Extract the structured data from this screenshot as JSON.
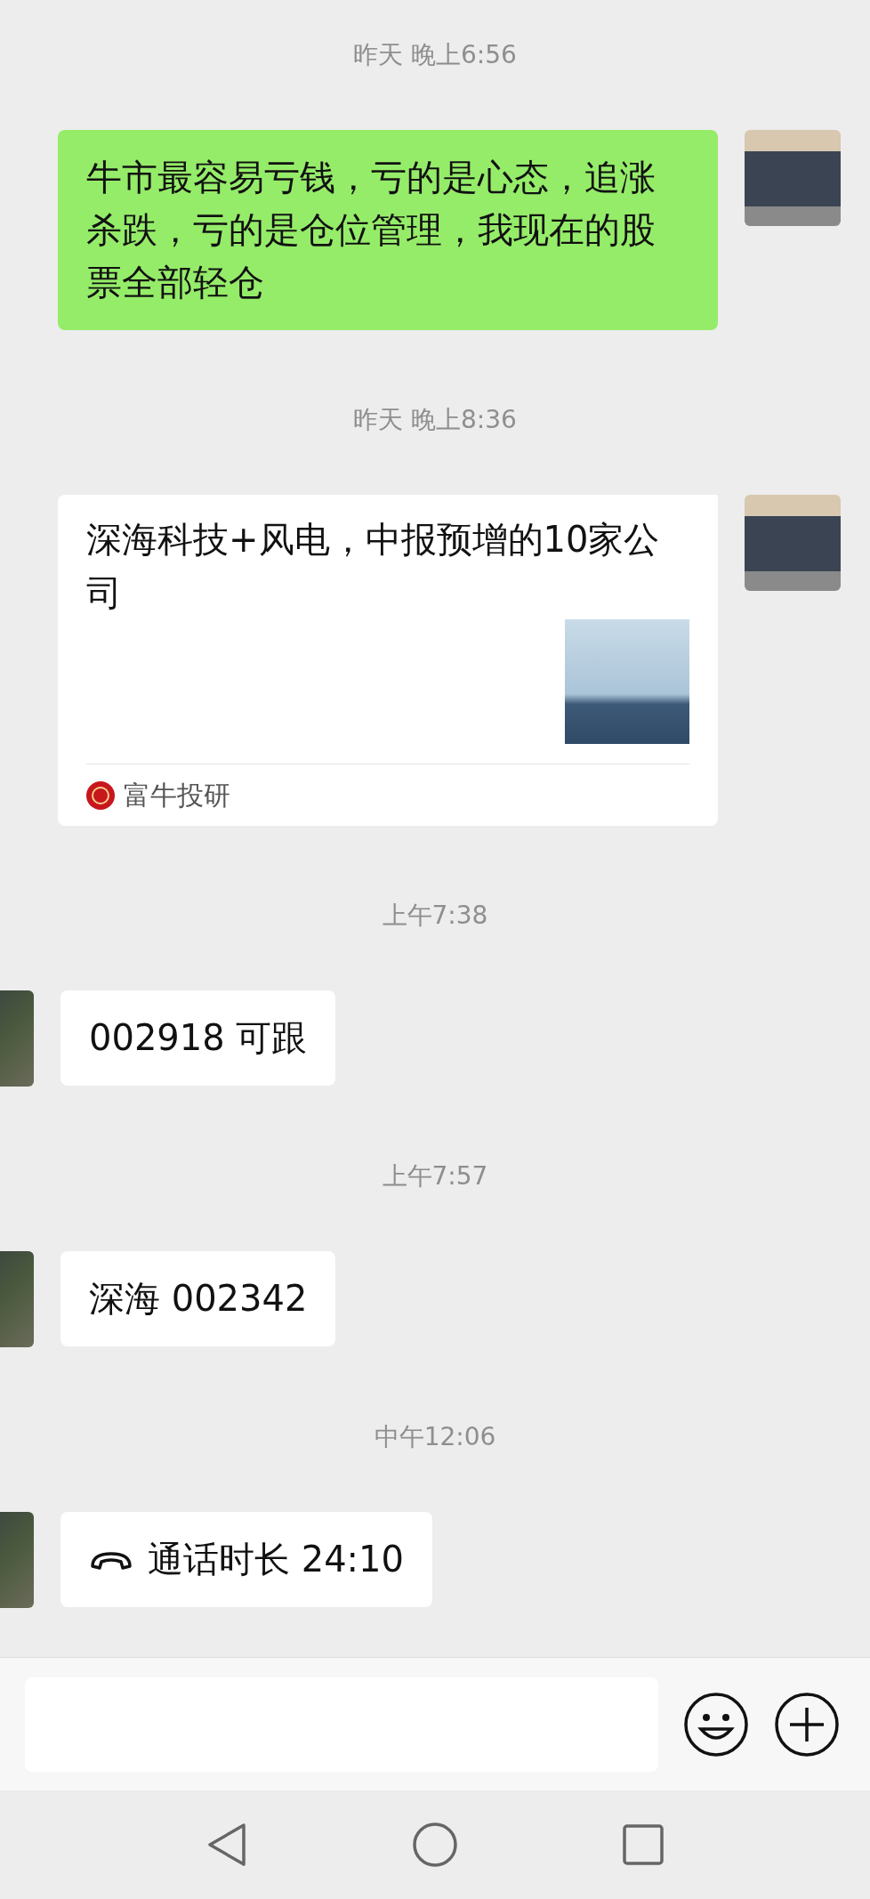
{
  "messages": [
    {
      "kind": "time",
      "text": "昨天 晚上6:56"
    },
    {
      "kind": "text",
      "mine": true,
      "text": "牛市最容易亏钱，亏的是心态，追涨杀跌，亏的是仓位管理，我现在的股票全部轻仓"
    },
    {
      "kind": "time",
      "text": "昨天 晚上8:36"
    },
    {
      "kind": "link",
      "mine": true,
      "title": "深海科技+风电，中报预增的10家公司",
      "source": "富牛投研"
    },
    {
      "kind": "time",
      "text": "上午7:38"
    },
    {
      "kind": "text",
      "mine": false,
      "text": "002918 可跟"
    },
    {
      "kind": "time",
      "text": "上午7:57"
    },
    {
      "kind": "text",
      "mine": false,
      "text": "深海 002342"
    },
    {
      "kind": "time",
      "text": "中午12:06"
    },
    {
      "kind": "call",
      "mine": false,
      "text": "通话时长 24:10"
    }
  ]
}
